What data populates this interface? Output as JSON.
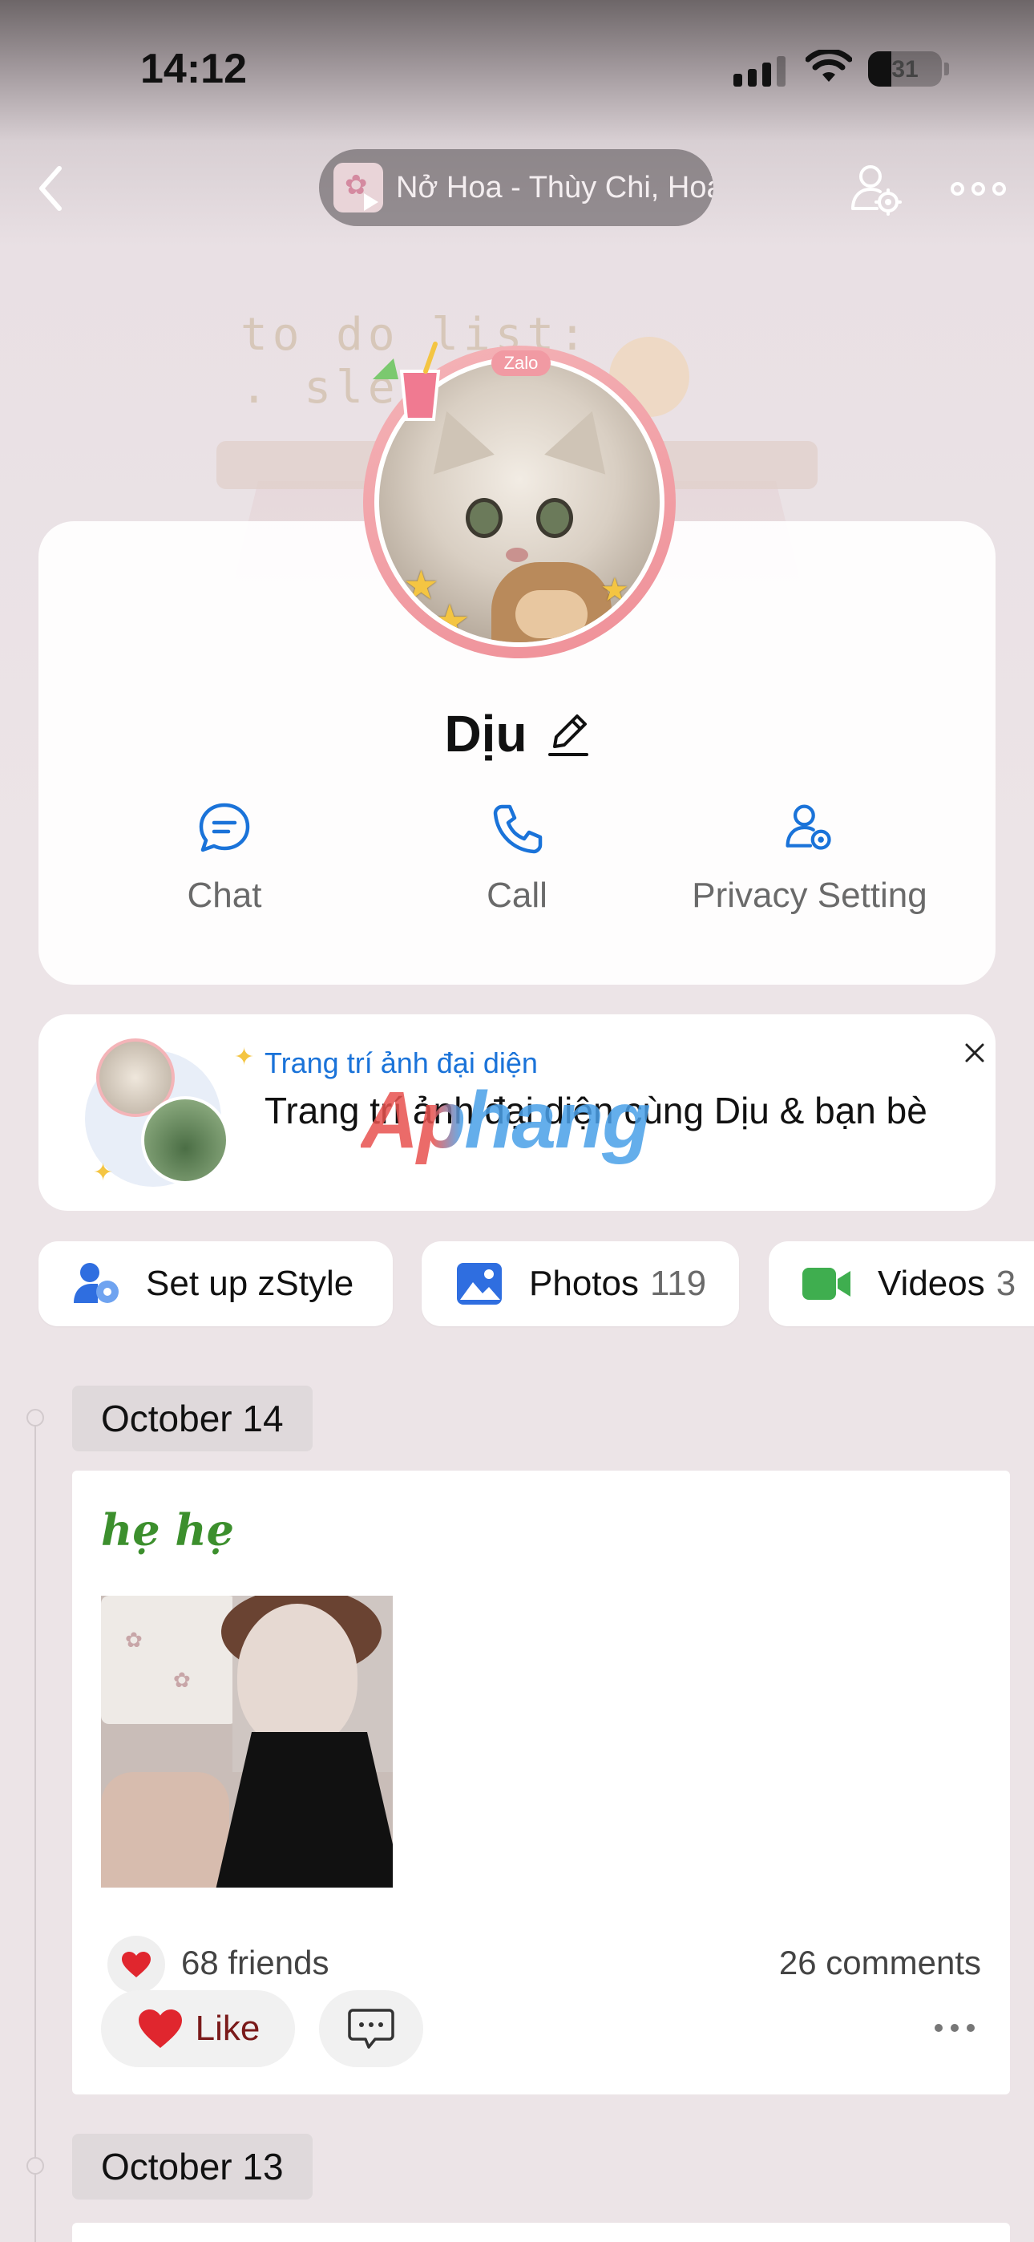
{
  "status_bar": {
    "time": "14:12",
    "battery": "31",
    "battery_level": 0.31
  },
  "top_nav": {
    "music_title": "Nở Hoa - Thùy Chi, Hoàng Dũng"
  },
  "profile": {
    "name": "Dịu",
    "avatar_badge": "Zalo",
    "actions": [
      {
        "label": "Chat",
        "icon": "chat-bubble-icon"
      },
      {
        "label": "Call",
        "icon": "phone-icon"
      },
      {
        "label": "Privacy Setting",
        "icon": "person-gear-icon"
      }
    ]
  },
  "decorate_banner": {
    "title": "Trang trí ảnh đại diện",
    "description": "Trang trí ảnh đại diện cùng Dịu & bạn bè"
  },
  "watermark": "Aphang",
  "chips": [
    {
      "label": "Set up zStyle",
      "count": "",
      "icon": "zstyle-icon",
      "color": "#2f6ee0"
    },
    {
      "label": "Photos",
      "count": "119",
      "icon": "photo-icon",
      "color": "#2f6ee0"
    },
    {
      "label": "Videos",
      "count": "3",
      "icon": "video-camera-icon",
      "color": "#3fae4f"
    }
  ],
  "timeline": [
    {
      "date": "October 14",
      "caption": "hẹ hẹ",
      "reactions": "68 friends",
      "comments": "26 comments",
      "like_label": "Like"
    },
    {
      "date": "October 13"
    }
  ],
  "colors": {
    "accent": "#1a73d9",
    "caption_green": "#3c8f2d",
    "heart": "#e0262e",
    "background": "#ece4e7"
  }
}
